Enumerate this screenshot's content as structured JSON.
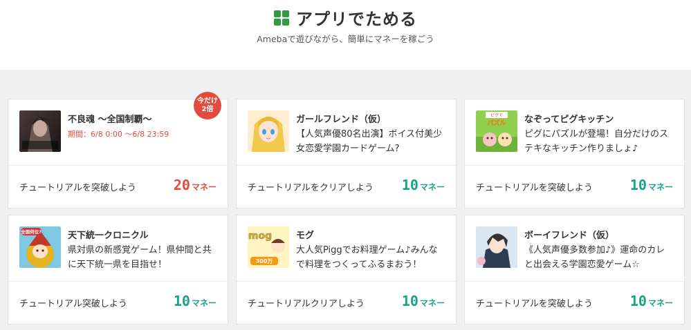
{
  "header": {
    "title": "アプリでためる",
    "subtitle": "Amebaで遊びながら、簡単にマネーを稼ごう"
  },
  "cards": [
    {
      "title": "不良魂 ～全国制覇～",
      "period": "期間：6/8 0:00 ～6/8 23:59",
      "badge_line1": "今だけ",
      "badge_line2": "2倍",
      "task": "チュートリアルを突破しよう",
      "reward": "20",
      "unit": "マネー",
      "reward_color": "#e24c3f"
    },
    {
      "title": "ガールフレンド（仮）",
      "desc": "【人気声優80名出演】ボイス付美少女恋愛学園カードゲーム?",
      "task": "チュートリアルをクリアしよう",
      "reward": "10",
      "unit": "マネー",
      "reward_color": "#1ba18a"
    },
    {
      "title": "なぞってピグキッチン",
      "desc": "ピグにパズルが登場！自分だけのステキなキッチン作りましょ♪",
      "task": "チュートリアルを突破しよう",
      "reward": "10",
      "unit": "マネー",
      "reward_color": "#1ba18a"
    },
    {
      "title": "天下統一クロニクル",
      "desc": "県対県の新感覚ゲーム！県仲間と共に天下統一県を目指せ！",
      "task": "チュートリアル突破しよう",
      "reward": "10",
      "unit": "マネー",
      "reward_color": "#1ba18a"
    },
    {
      "title": "モグ",
      "desc": "大人気Piggでお料理ゲーム♪みんなで料理をつくってふるまおう！",
      "task": "チュートリアルクリアしよう",
      "reward": "10",
      "unit": "マネー",
      "reward_color": "#1ba18a"
    },
    {
      "title": "ボーイフレンド（仮）",
      "desc": "《人気声優多数参加♪》運命のカレと出会える学園恋愛ゲーム☆",
      "task": "チュートリアルを突破しよう",
      "reward": "10",
      "unit": "マネー",
      "reward_color": "#1ba18a"
    }
  ],
  "thumb_text": {
    "pig_kitchen_top": "ピグで",
    "pig_kitchen_main": "パズル",
    "tenka": "全国何位?",
    "mog_logo": "mog",
    "mog_count": "300万"
  }
}
